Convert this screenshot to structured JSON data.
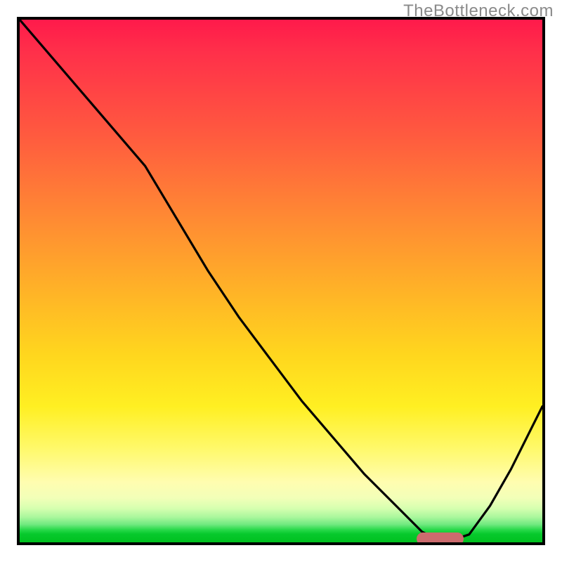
{
  "watermark": "TheBottleneck.com",
  "colors": {
    "frame": "#000000",
    "curve": "#000000",
    "marker": "#cc6b6e",
    "watermark_text": "#8a8a8a"
  },
  "chart_data": {
    "type": "line",
    "title": "",
    "xlabel": "",
    "ylabel": "",
    "xlim": [
      0,
      100
    ],
    "ylim": [
      0,
      100
    ],
    "grid": false,
    "legend": false,
    "note": "Axes are unlabeled in the image; x and y are normalized 0–100 (y=0 at bottom). Curve values estimated from pixel positions.",
    "series": [
      {
        "name": "bottleneck-curve",
        "x": [
          0,
          6,
          12,
          18,
          24,
          30,
          36,
          42,
          48,
          54,
          60,
          66,
          72,
          77,
          80,
          83,
          86,
          90,
          94,
          98,
          100
        ],
        "y": [
          100,
          93,
          86,
          79,
          72,
          62,
          52,
          43,
          35,
          27,
          20,
          13,
          7,
          2,
          0.5,
          0.5,
          1.5,
          7,
          14,
          22,
          26
        ]
      }
    ],
    "marker": {
      "name": "highlight-range",
      "x_start": 76,
      "x_end": 85,
      "y": 0.7
    },
    "background_gradient_stops": [
      {
        "pos": 0.0,
        "color": "#ff1a4b"
      },
      {
        "pos": 0.22,
        "color": "#ff5a3f"
      },
      {
        "pos": 0.52,
        "color": "#ffb327"
      },
      {
        "pos": 0.74,
        "color": "#ffef22"
      },
      {
        "pos": 0.9,
        "color": "#f6ffc0"
      },
      {
        "pos": 0.96,
        "color": "#6fe97f"
      },
      {
        "pos": 1.0,
        "color": "#00c11f"
      }
    ]
  }
}
